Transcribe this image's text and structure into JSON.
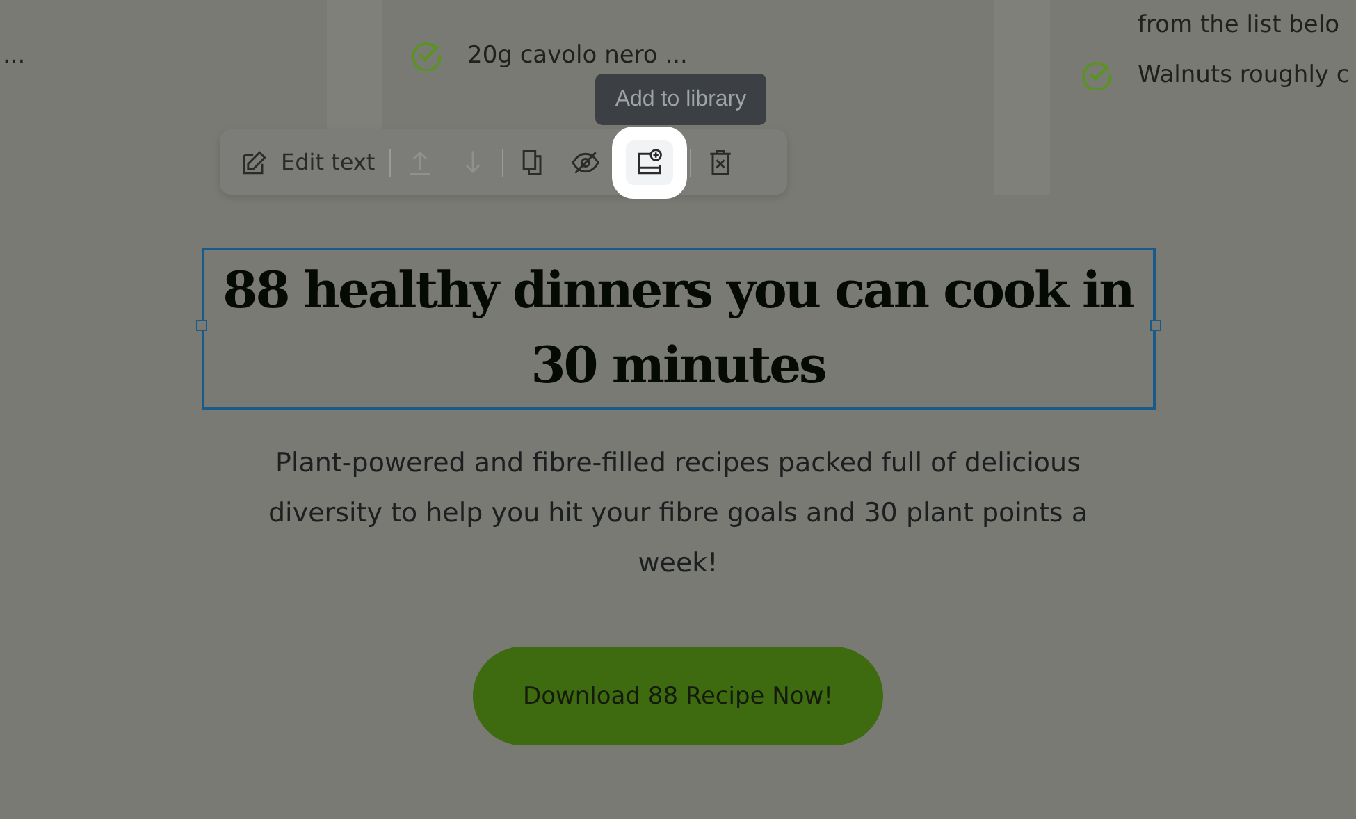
{
  "background_cards": [
    {
      "items": [
        {
          "text": "...",
          "checked": false
        }
      ]
    },
    {
      "items": [
        {
          "text": "20g cavolo nero ...",
          "checked": true
        }
      ]
    },
    {
      "items": [
        {
          "text": "from the list belo",
          "checked": false
        },
        {
          "text": "Walnuts roughly c",
          "checked": true
        }
      ]
    }
  ],
  "toolbar": {
    "items": [
      {
        "kind": "edit",
        "label": "Edit text",
        "disabled": false,
        "selected": false
      },
      {
        "kind": "up",
        "disabled": true,
        "selected": false
      },
      {
        "kind": "down",
        "disabled": true,
        "selected": false
      },
      {
        "kind": "duplicate",
        "disabled": false,
        "selected": false
      },
      {
        "kind": "hide",
        "disabled": false,
        "selected": false
      },
      {
        "kind": "library",
        "disabled": false,
        "selected": true
      },
      {
        "kind": "delete",
        "disabled": false,
        "selected": false
      }
    ],
    "tooltip": "Add to library"
  },
  "heading": {
    "text": "88 healthy dinners you can cook in 30 minutes",
    "selected": true
  },
  "description": "Plant-powered and fibre-filled recipes packed full of delicious diversity to help you hit your fibre goals and 30 plant points a week!",
  "cta_button": "Download 88 Recipe Now!"
}
